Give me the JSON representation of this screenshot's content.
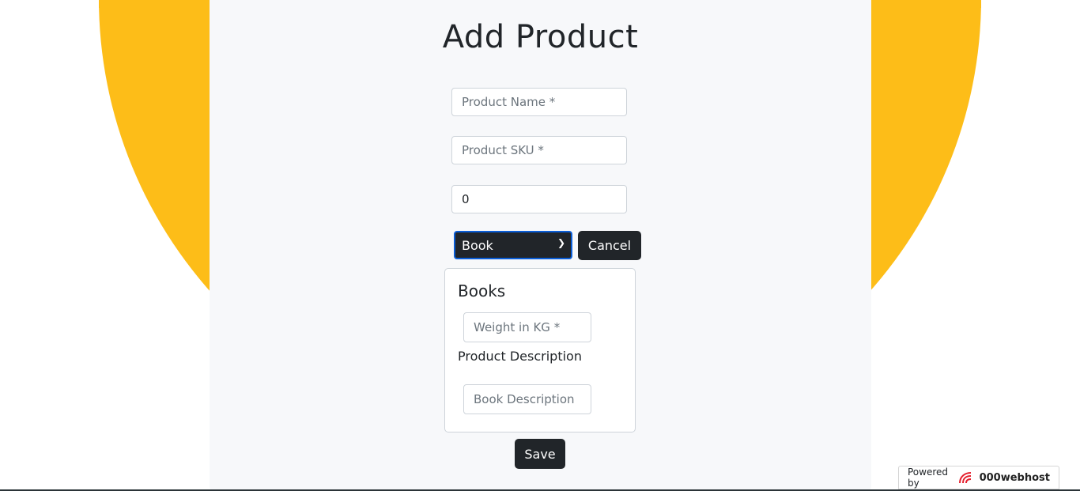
{
  "page": {
    "title": "Add Product"
  },
  "form": {
    "name_placeholder": "Product Name *",
    "sku_placeholder": "Product SKU *",
    "price_value": "0",
    "type_selected": "Book",
    "cancel_label": "Cancel",
    "save_label": "Save"
  },
  "books": {
    "title": "Books",
    "weight_placeholder": "Weight in KG *",
    "description_label": "Product Description",
    "description_placeholder": "Book Description"
  },
  "footer": {
    "powered_by": "Powered by",
    "brand": "000webhost"
  },
  "colors": {
    "accent": "#fdbd18",
    "dark": "#212529",
    "panel": "#f7f8fa",
    "logo": "#e5202e"
  }
}
